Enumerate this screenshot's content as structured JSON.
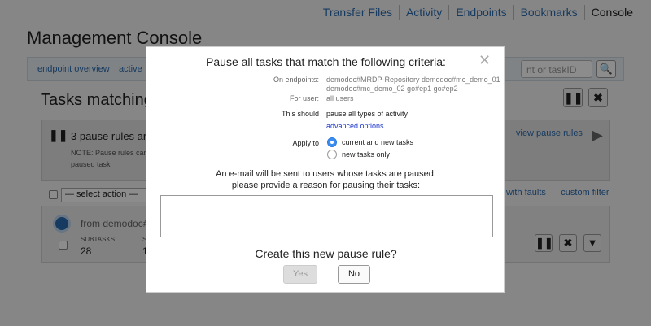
{
  "nav": {
    "items": [
      "Transfer Files",
      "Activity",
      "Endpoints",
      "Bookmarks",
      "Console"
    ]
  },
  "page": {
    "title": "Management Console",
    "tabs": {
      "overview": "endpoint overview",
      "active": "active"
    },
    "search_placeholder": "nt or taskID",
    "search_icon": "magnifier",
    "tasks_heading": "Tasks matching",
    "rules_summary": "3 pause rules are",
    "rules_note": "NOTE: Pause rules can currently paused task",
    "view_pause_rules": "view pause rules",
    "select_action": "— select action —",
    "filter_with_faults": "with faults",
    "filter_custom": "custom filter",
    "task_from": "from demodoc#e",
    "subtasks_label": "SUBTASKS",
    "subtasks_value": "28",
    "hidden_col_label": "S",
    "hidden_col_value": "1"
  },
  "modal": {
    "title": "Pause all tasks that match the following criteria:",
    "close_glyph": "✕",
    "endpoints_label": "On endpoints:",
    "endpoints_value": "demodoc#MRDP-Repository demodoc#mc_demo_01 demodoc#mc_demo_02 go#ep1 go#ep2",
    "user_label": "For user:",
    "user_value": "all users",
    "should_label": "This should",
    "should_value": "pause all types of activity",
    "advanced_options": "advanced options",
    "apply_label": "Apply to",
    "apply_options": [
      {
        "label": "current and new tasks",
        "selected": true
      },
      {
        "label": "new tasks only",
        "selected": false
      }
    ],
    "email_line1": "An e-mail will be sent to users whose tasks are paused,",
    "email_line2": "please provide a reason for pausing their tasks:",
    "reason_value": "",
    "confirm_question": "Create this new pause rule?",
    "yes_label": "Yes",
    "no_label": "No"
  }
}
